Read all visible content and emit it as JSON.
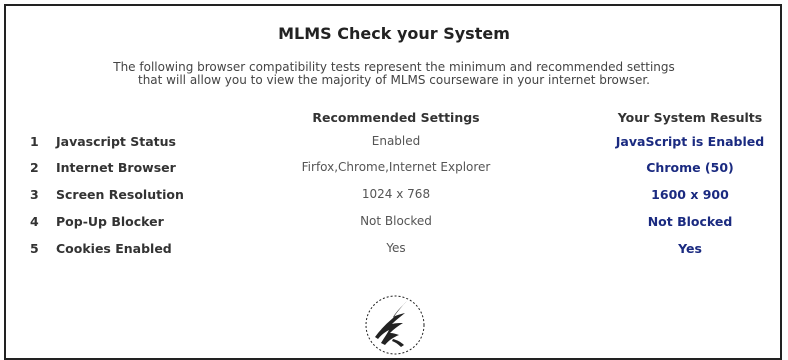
{
  "page": {
    "title": "MLMS Check your System",
    "intro_line1": "The following browser compatibility tests represent the minimum and recommended settings",
    "intro_line2": "that will allow you to view the majority of MLMS courseware in your internet browser."
  },
  "table": {
    "headers": {
      "recommended": "Recommended Settings",
      "results": "Your System Results"
    },
    "rows": [
      {
        "num": "1",
        "label": "Javascript Status",
        "recommended": "Enabled",
        "result": "JavaScript is Enabled"
      },
      {
        "num": "2",
        "label": "Internet Browser",
        "recommended": "Firfox,Chrome,Internet Explorer",
        "result": "Chrome (50)"
      },
      {
        "num": "3",
        "label": "Screen Resolution",
        "recommended": "1024 x 768",
        "result": "1600 x 900"
      },
      {
        "num": "4",
        "label": "Pop-Up Blocker",
        "recommended": "Not Blocked",
        "result": "Not Blocked"
      },
      {
        "num": "5",
        "label": "Cookies Enabled",
        "recommended": "Yes",
        "result": "Yes"
      }
    ]
  },
  "colors": {
    "result_text": "#1a2a80",
    "label_text": "#333333",
    "border": "#222222"
  },
  "icons": {
    "seal": "hhs-eagle-seal-icon"
  }
}
